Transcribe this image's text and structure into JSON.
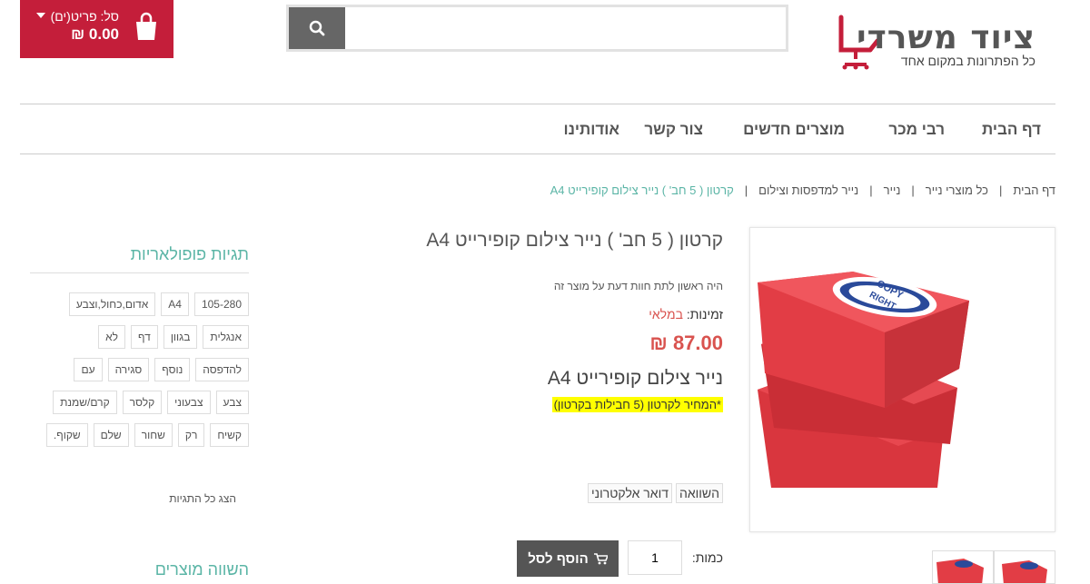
{
  "header": {
    "logo_title": "ציוד משרדי",
    "logo_subtitle": "כל הפתרונות במקום אחד",
    "search_placeholder": "",
    "cart_label": "סל: פריט(ים)",
    "cart_total": "0.00 ₪"
  },
  "nav": {
    "items": [
      {
        "label": "דף הבית"
      },
      {
        "label": "רבי מכר"
      },
      {
        "label": "מוצרים חדשים"
      },
      {
        "label": "צור קשר"
      },
      {
        "label": "אודותינו"
      }
    ]
  },
  "breadcrumb": {
    "items": [
      "דף הבית",
      "כל מוצרי נייר",
      "נייר",
      "נייר למדפסות וצילום"
    ],
    "current": "קרטון ( 5 חב' ) נייר צילום קופירייט A4"
  },
  "product": {
    "title": "קרטון ( 5 חב' ) נייר צילום קופירייט A4",
    "review_text": "היה ראשון לתת חוות דעת על מוצר זה",
    "availability_label": "זמינות:",
    "availability_value": "במלאי",
    "price": "87.00 ₪",
    "subtitle": "נייר צילום קופירייט A4",
    "note": "*המחיר לקרטון (5 חבילות בקרטון)",
    "compare_label": "השוואה",
    "email_label": "דואר אלקטרוני",
    "qty_label": "כמות:",
    "qty_value": "1",
    "add_to_cart": "הוסף לסל",
    "box_label_line1": "COPY",
    "box_label_line2": "RIGHT"
  },
  "sidebar": {
    "tags_title": "תגיות פופולאריות",
    "tags": [
      "105-280",
      "A4",
      "אדום,כחול,וצבע",
      "אנגלית",
      "בגוון",
      "דף",
      "לא",
      "להדפסה",
      "נוסף",
      "סגירה",
      "עם",
      "צבע",
      "צבעוני",
      "קלסר",
      "קרם/שמנת",
      "קשיח",
      "רק",
      "שחור",
      "שלם",
      "שקוף."
    ],
    "all_tags_label": "הצג כל התגיות",
    "compare_title": "השווה מוצרים"
  },
  "colors": {
    "brand_red": "#c41e3a",
    "accent_teal": "#5bb5a6",
    "price_red": "#d9534f",
    "highlight_yellow": "#ffff00"
  }
}
